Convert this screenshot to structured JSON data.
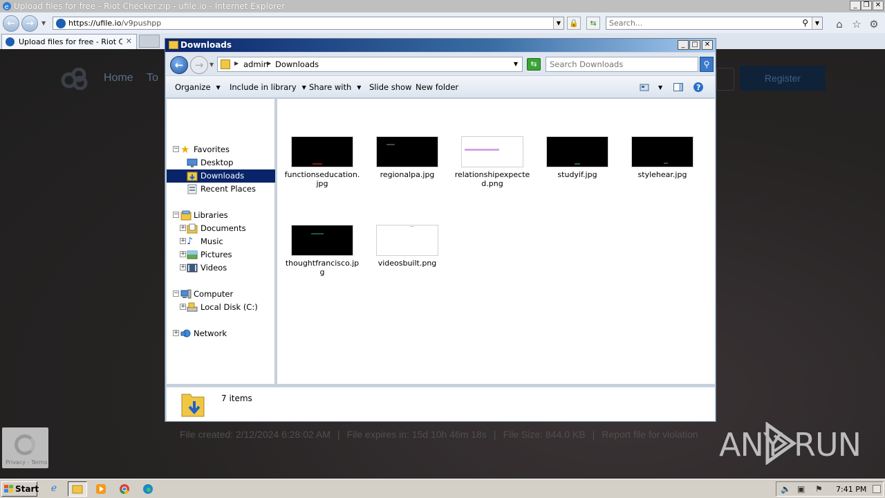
{
  "browser": {
    "title": "Upload files for free - Riot Checker.zip - ufile.io - Internet Explorer",
    "address_host": "https://ufile.io",
    "address_path": "/v9pushpp",
    "search_placeholder": "Search...",
    "tab_label": "Upload files for free - Riot C...",
    "tab_close": "✕"
  },
  "site": {
    "nav": [
      "Home",
      "To"
    ],
    "register_label": "Register",
    "file_created": "File created: 2/12/2024 6:28:02 AM",
    "file_expires": "File expires in: 15d 10h 46m 18s",
    "file_size": "File Size: 844.0 KB",
    "report_link": "Report file for violation",
    "separator": "|",
    "recaptcha_text": "Privacy - Terms",
    "watermark_left": "ANY",
    "watermark_right": "RUN"
  },
  "explorer": {
    "title": "Downloads",
    "breadcrumb": [
      "admin",
      "Downloads"
    ],
    "search_placeholder": "Search Downloads",
    "toolbar": {
      "organize": "Organize",
      "include_in_library": "Include in library",
      "share_with": "Share with",
      "slide_show": "Slide show",
      "new_folder": "New folder"
    },
    "tree": {
      "favorites": "Favorites",
      "desktop": "Desktop",
      "downloads": "Downloads",
      "recent_places": "Recent Places",
      "libraries": "Libraries",
      "documents": "Documents",
      "music": "Music",
      "pictures": "Pictures",
      "videos": "Videos",
      "computer": "Computer",
      "local_disk": "Local Disk (C:)",
      "network": "Network"
    },
    "files": [
      {
        "name": "functionseducation.jpg",
        "thumb": "#000000"
      },
      {
        "name": "regionalpa.jpg",
        "thumb": "#000000"
      },
      {
        "name": "relationshipexpected.png",
        "thumb": "#ffffff"
      },
      {
        "name": "studyif.jpg",
        "thumb": "#000000"
      },
      {
        "name": "stylehear.jpg",
        "thumb": "#000000"
      },
      {
        "name": "thoughtfrancisco.jpg",
        "thumb": "#000000"
      },
      {
        "name": "videosbuilt.png",
        "thumb": "#ffffff"
      }
    ],
    "status_count": "7 items"
  },
  "taskbar": {
    "start_label": "Start",
    "clock": "7:41 PM"
  },
  "colors": {
    "selection": "#0a246a",
    "explorer_title_start": "#0a246a",
    "site_register_bg": "#0f2238"
  }
}
